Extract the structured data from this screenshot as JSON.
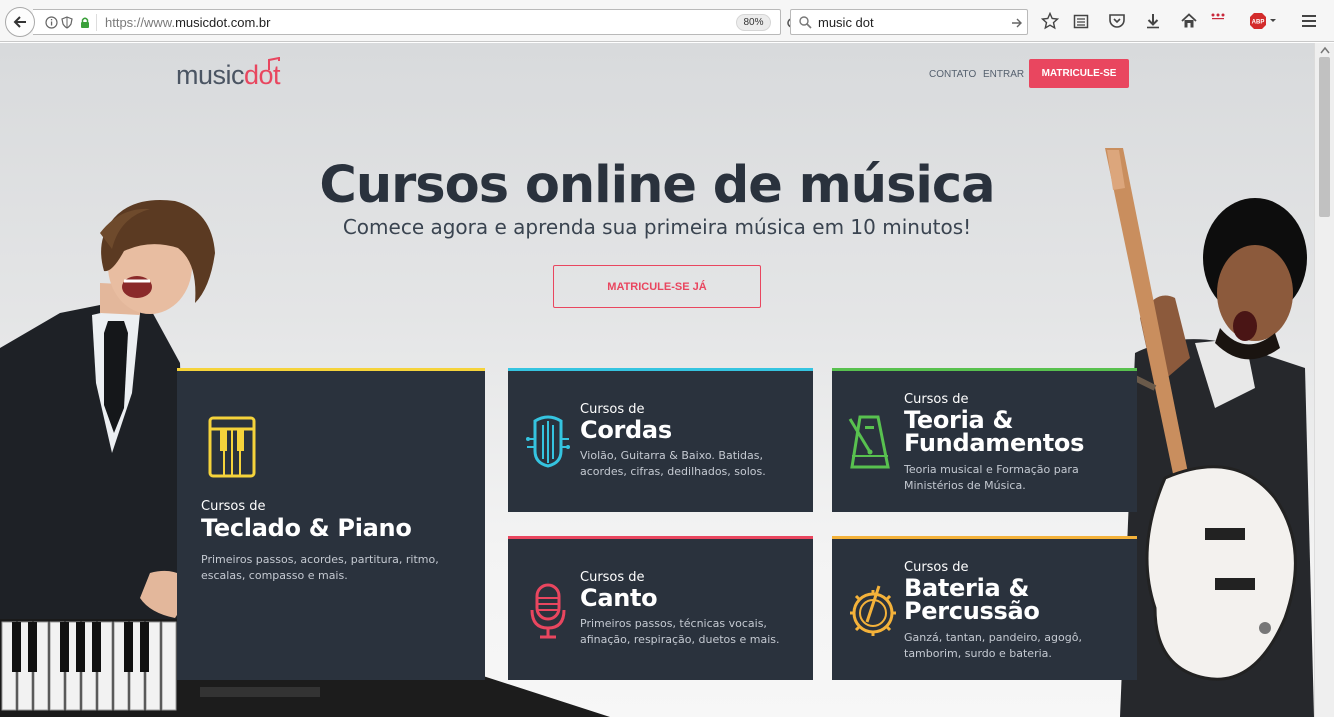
{
  "browser": {
    "url_prefix": "https://www.",
    "url_domain": "musicdot.com.br",
    "zoom": "80%",
    "search_query": "music dot"
  },
  "header": {
    "logo_prefix": "music",
    "logo_suffix": "dot",
    "nav": {
      "contact": "CONTATO",
      "login": "ENTRAR",
      "signup": "MATRICULE-SE"
    }
  },
  "hero": {
    "title": "Cursos online de música",
    "subtitle": "Comece agora e aprenda sua primeira música em 10 minutos!",
    "cta": "MATRICULE-SE JÁ"
  },
  "courses": [
    {
      "pre": "Cursos de",
      "title": "Teclado & Piano",
      "description": "Primeiros passos, acordes, partitura, ritmo, escalas, compasso e mais.",
      "icon": "piano-icon",
      "accent": "#f5d33b"
    },
    {
      "pre": "Cursos de",
      "title": "Cordas",
      "description": "Violão, Guitarra & Baixo. Batidas, acordes, cifras, dedilhados, solos.",
      "icon": "guitar-icon",
      "accent": "#35c4e0"
    },
    {
      "pre": "Cursos de",
      "title_line1": "Teoria &",
      "title_line2": "Fundamentos",
      "description": "Teoria musical e Formação para Ministérios de Música.",
      "icon": "metronome-icon",
      "accent": "#58c14f"
    },
    {
      "pre": "Cursos de",
      "title": "Canto",
      "description": "Primeiros passos, técnicas vocais, afinação, respiração, duetos e mais.",
      "icon": "microphone-icon",
      "accent": "#e9465f"
    },
    {
      "pre": "Cursos de",
      "title_line1": "Bateria &",
      "title_line2": "Percussão",
      "description": "Ganzá, tantan, pandeiro, agogô, tamborim, surdo e bateria.",
      "icon": "drum-icon",
      "accent": "#f4b23a"
    }
  ]
}
